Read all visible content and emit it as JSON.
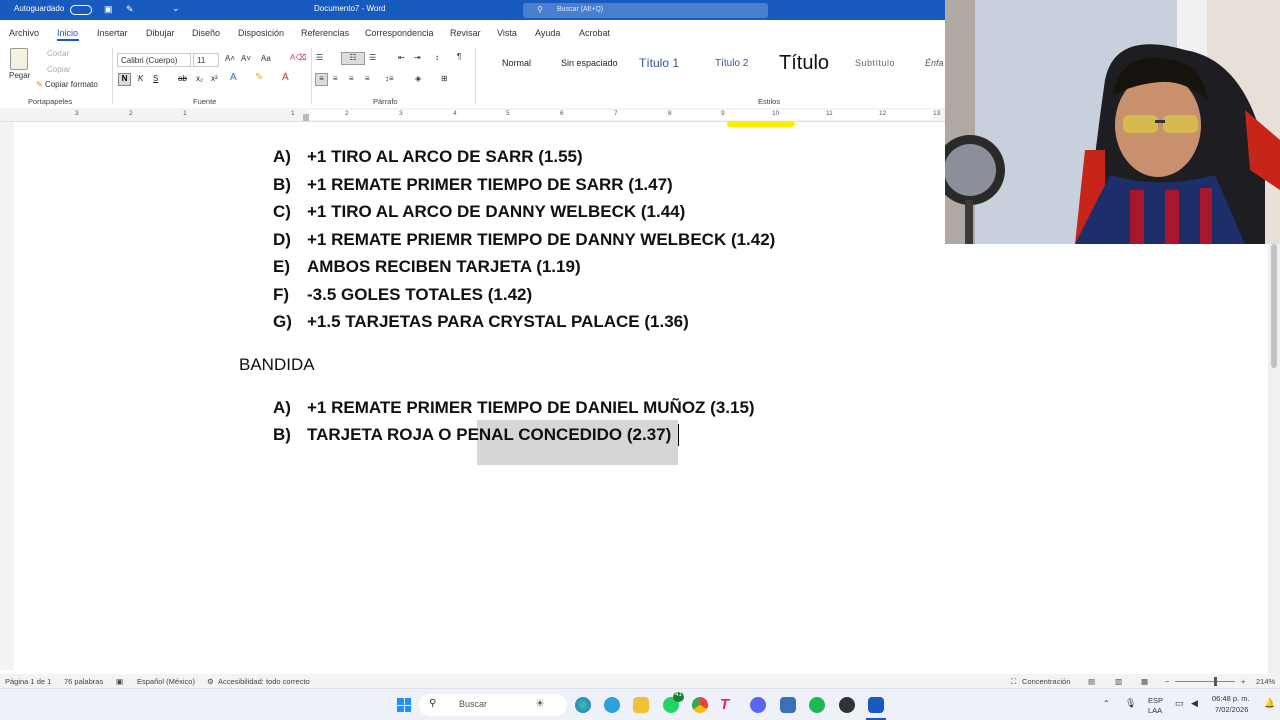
{
  "titlebar": {
    "autosave": "Autoguardado",
    "doc_name": "Documento7 - Word",
    "search_placeholder": "Buscar (Alt+Q)"
  },
  "menu_tabs": [
    "Archivo",
    "Inicio",
    "Insertar",
    "Dibujar",
    "Diseño",
    "Disposición",
    "Referencias",
    "Correspondencia",
    "Revisar",
    "Vista",
    "Ayuda",
    "Acrobat"
  ],
  "active_tab": "Inicio",
  "ribbon": {
    "clipboard": {
      "paste": "Pegar",
      "cut": "Cortar",
      "copy": "Copiar",
      "format_painter": "Copiar formato",
      "label": "Portapapeles"
    },
    "font": {
      "family": "Calibri (Cuerpo)",
      "size": "11",
      "label": "Fuente",
      "bold": "N",
      "italic": "K",
      "underline": "S"
    },
    "paragraph": {
      "label": "Párrafo"
    },
    "styles": {
      "label": "Estilos",
      "items": [
        "Normal",
        "Sin espaciado",
        "Título 1",
        "Título 2",
        "Título",
        "Subtítulo",
        "Énfa"
      ]
    }
  },
  "ruler": {
    "numbers": [
      "3",
      "2",
      "1",
      "1",
      "2",
      "3",
      "4",
      "5",
      "6",
      "7",
      "8",
      "9",
      "10",
      "11",
      "12",
      "13"
    ]
  },
  "document": {
    "list1": [
      {
        "letter": "A)",
        "text": "+1 TIRO AL ARCO DE SARR (1.55)"
      },
      {
        "letter": "B)",
        "text": "+1 REMATE PRIMER TIEMPO DE SARR (1.47)"
      },
      {
        "letter": "C)",
        "text": "+1 TIRO AL ARCO DE DANNY WELBECK (1.44)"
      },
      {
        "letter": "D)",
        "text": "+1 REMATE PRIEMR TIEMPO DE DANNY WELBECK (1.42)"
      },
      {
        "letter": "E)",
        "text": "AMBOS RECIBEN TARJETA (1.19)"
      },
      {
        "letter": "F)",
        "text": "-3.5 GOLES TOTALES (1.42)"
      },
      {
        "letter": "G)",
        "text": "+1.5 TARJETAS PARA CRYSTAL PALACE (1.36)"
      }
    ],
    "heading": "BANDIDA",
    "list2": [
      {
        "letter": "A)",
        "text": "+1 REMATE PRIMER TIEMPO DE DANIEL MUÑOZ (3.15)"
      },
      {
        "letter": "B)",
        "text": "TARJETA ROJA O PENAL CONCEDIDO (2.37)"
      }
    ]
  },
  "statusbar": {
    "page": "Página 1 de 1",
    "words": "76 palabras",
    "language": "Español (México)",
    "accessibility": "Accesibilidad: todo correcto",
    "focus": "Concentración",
    "zoom": "214%"
  },
  "taskbar": {
    "search": "Buscar",
    "lang": "ESP",
    "lang2": "LAA",
    "time": "06:48 p. m.",
    "date": "7/02/2026",
    "whatsapp_badge": "41"
  },
  "colors": {
    "word_blue": "#185abd",
    "selection": "#d6d6d6",
    "highlight_mark": "#ffee00"
  }
}
